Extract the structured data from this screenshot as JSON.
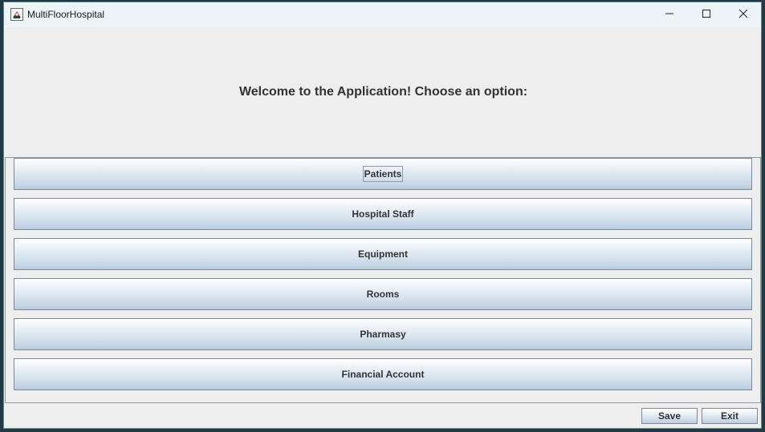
{
  "window": {
    "title": "MultiFloorHospital"
  },
  "header": {
    "welcome": "Welcome to the Application! Choose an option:"
  },
  "menu": {
    "items": [
      {
        "label": "Patients"
      },
      {
        "label": "Hospital Staff"
      },
      {
        "label": "Equipment"
      },
      {
        "label": "Rooms"
      },
      {
        "label": "Pharmasy"
      },
      {
        "label": "Financial Account"
      }
    ]
  },
  "footer": {
    "save_label": "Save",
    "exit_label": "Exit"
  },
  "colors": {
    "button_gradient_top": "#ffffff",
    "button_gradient_bottom": "#b8cadc",
    "button_border": "#7a8a99",
    "background": "#eeeeee",
    "titlebar": "#ebf4f7"
  },
  "icons": {
    "app": "java-app-icon",
    "minimize": "minimize-icon",
    "maximize": "maximize-icon",
    "close": "close-icon"
  }
}
